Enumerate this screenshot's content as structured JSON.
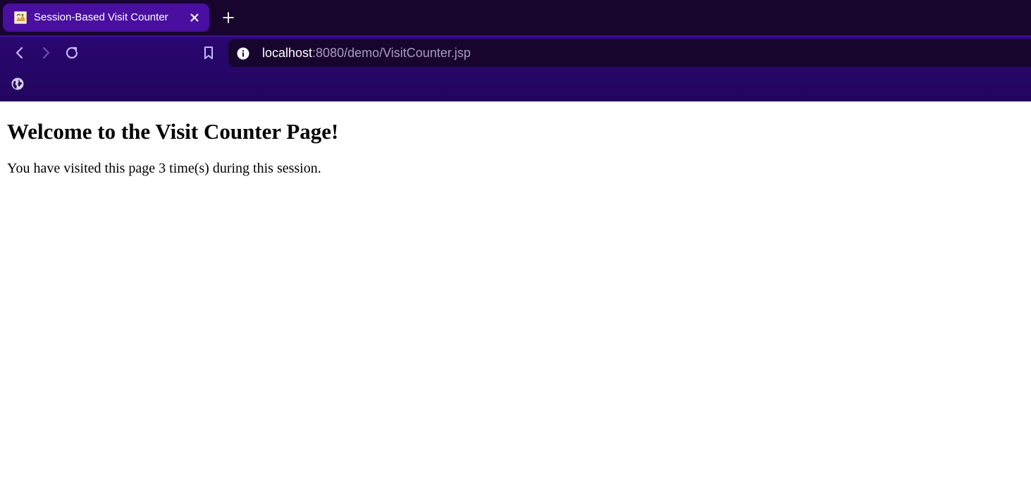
{
  "browser": {
    "tab": {
      "title": "Session-Based Visit Counter",
      "favicon": "tomcat-icon",
      "close_icon": "close-icon"
    },
    "new_tab_icon": "plus-icon",
    "nav": {
      "back_icon": "back-arrow-icon",
      "forward_icon": "forward-arrow-icon",
      "reload_icon": "reload-icon",
      "bookmark_icon": "bookmark-icon"
    },
    "address": {
      "info_icon": "info-icon",
      "host": "localhost",
      "rest": ":8080/demo/VisitCounter.jsp"
    },
    "bookmarks_bar": {
      "globe_icon": "globe-icon"
    },
    "colors": {
      "tabstrip": "#17052e",
      "active_tab": "#4a0fa0",
      "toolbar": "#22055e"
    }
  },
  "page": {
    "heading": "Welcome to the Visit Counter Page!",
    "message": "You have visited this page 3 time(s) during this session."
  }
}
